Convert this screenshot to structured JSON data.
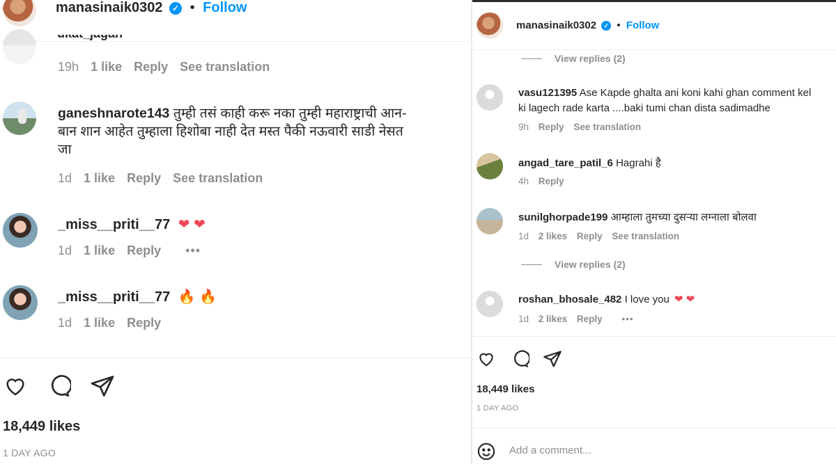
{
  "header": {
    "username": "manasinaik0302",
    "separator": "•",
    "follow_label": "Follow",
    "verified_glyph": "✓"
  },
  "left": {
    "cut_comment": {
      "username": "ukat_jagan",
      "meta": {
        "age": "19h",
        "likes": "1 like",
        "reply": "Reply",
        "translate": "See translation"
      }
    },
    "comments": [
      {
        "username": "ganeshnarote143",
        "text_line1": "तुम्ही तसं काही करू नका तुम्ही महाराष्ट्राची आन-",
        "text_line2": "बान शान आहेत तुम्हाला हिशोबा नाही देत मस्त पैकी नऊवारी साडी नेसत",
        "text_line3": "जा",
        "meta": {
          "age": "1d",
          "likes": "1 like",
          "reply": "Reply",
          "translate": "See translation"
        }
      },
      {
        "username": "_miss__priti__77",
        "text": "❤ ❤",
        "meta": {
          "age": "1d",
          "likes": "1 like",
          "reply": "Reply",
          "more": "•••"
        }
      },
      {
        "username": "_miss__priti__77",
        "text": "🔥 🔥",
        "meta": {
          "age": "1d",
          "likes": "1 like",
          "reply": "Reply"
        }
      }
    ],
    "likes": "18,449 likes",
    "date": "1 DAY AGO"
  },
  "right": {
    "view_replies_1": "View replies (2)",
    "comments": [
      {
        "username": "vasu121395",
        "text_line1": "Ase Kapde ghalta ani koni kahi ghan comment kel",
        "text_line2": "ki lagech rade karta ....baki tumi chan dista sadimadhe",
        "meta": {
          "age": "9h",
          "reply": "Reply",
          "translate": "See translation"
        }
      },
      {
        "username": "angad_tare_patil_6",
        "text": "Hagrahi है",
        "meta": {
          "age": "4h",
          "reply": "Reply"
        }
      },
      {
        "username": "sunilghorpade199",
        "text": "आम्हाला तुमच्या दुसऱ्या लग्नाला बोलवा",
        "meta": {
          "age": "1d",
          "likes": "2 likes",
          "reply": "Reply",
          "translate": "See translation"
        }
      },
      {
        "username": "roshan_bhosale_482",
        "text": "I love you",
        "hearts": "❤ ❤",
        "meta": {
          "age": "1d",
          "likes": "2 likes",
          "reply": "Reply",
          "more": "•••"
        }
      }
    ],
    "view_replies_2": "View replies (2)",
    "likes": "18,449 likes",
    "date": "1 DAY AGO",
    "add_comment_placeholder": "Add a comment..."
  },
  "icons": [
    "heart-icon",
    "comment-icon",
    "share-icon",
    "emoji-icon",
    "verified-icon"
  ],
  "colors": {
    "accent": "#0095f6",
    "heart": "#ed4956",
    "muted": "#8e8e8e",
    "text": "#262626"
  }
}
